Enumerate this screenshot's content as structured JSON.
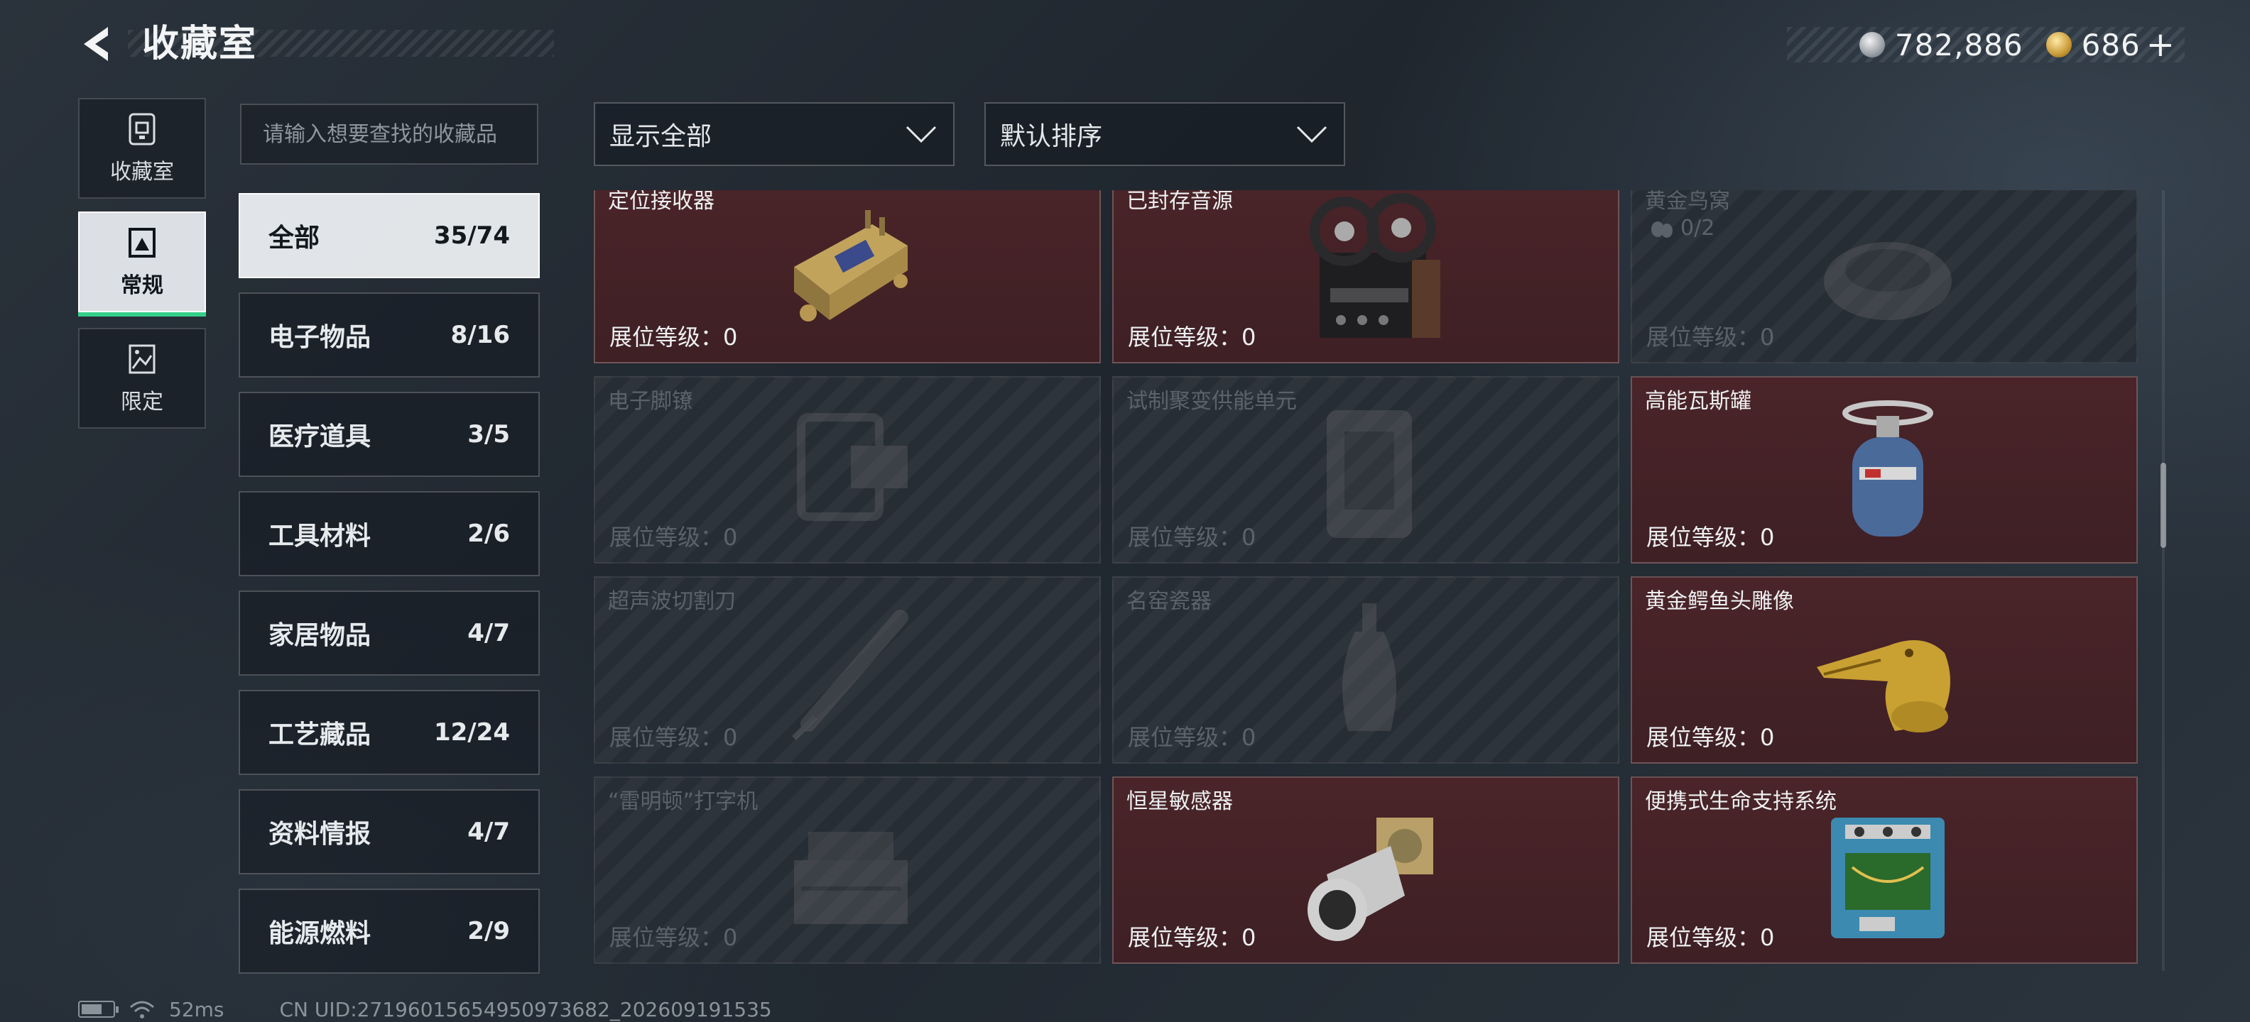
{
  "header": {
    "title": "收藏室"
  },
  "currency": {
    "silver": "782,886",
    "gold": "686",
    "plus": "+"
  },
  "side_tabs": [
    {
      "label": "收藏室",
      "icon": "vault-icon"
    },
    {
      "label": "常规",
      "icon": "picture-frame-icon",
      "active": true
    },
    {
      "label": "限定",
      "icon": "limited-frame-icon"
    }
  ],
  "search": {
    "placeholder": "请输入想要查找的收藏品"
  },
  "filters": {
    "show": "显示全部",
    "sort": "默认排序"
  },
  "categories": [
    {
      "name": "全部",
      "count": "35/74",
      "active": true
    },
    {
      "name": "电子物品",
      "count": "8/16"
    },
    {
      "name": "医疗道具",
      "count": "3/5"
    },
    {
      "name": "工具材料",
      "count": "2/6"
    },
    {
      "name": "家居物品",
      "count": "4/7"
    },
    {
      "name": "工艺藏品",
      "count": "12/24"
    },
    {
      "name": "资料情报",
      "count": "4/7"
    },
    {
      "name": "能源燃料",
      "count": "2/9"
    }
  ],
  "level_label": "展位等级：0",
  "items": [
    {
      "name": "定位接收器",
      "owned": true,
      "icon": "gps-receiver-icon"
    },
    {
      "name": "已封存音源",
      "owned": true,
      "icon": "reel-tape-recorder-icon"
    },
    {
      "name": "黄金鸟窝",
      "owned": false,
      "icon": "golden-nest-icon",
      "sub": "0/2"
    },
    {
      "name": "电子脚镣",
      "owned": false,
      "icon": "ankle-monitor-icon"
    },
    {
      "name": "试制聚变供能单元",
      "owned": false,
      "icon": "fusion-cell-icon"
    },
    {
      "name": "高能瓦斯罐",
      "owned": true,
      "icon": "gas-tank-icon"
    },
    {
      "name": "超声波切割刀",
      "owned": false,
      "icon": "ultrasonic-cutter-icon"
    },
    {
      "name": "名窑瓷器",
      "owned": false,
      "icon": "porcelain-vase-icon"
    },
    {
      "name": "黄金鳄鱼头雕像",
      "owned": true,
      "icon": "golden-crocodile-statue-icon"
    },
    {
      "name": "“雷明顿”打字机",
      "owned": false,
      "icon": "typewriter-icon"
    },
    {
      "name": "恒星敏感器",
      "owned": true,
      "icon": "star-sensor-icon"
    },
    {
      "name": "便携式生命支持系统",
      "owned": true,
      "icon": "life-support-system-icon"
    }
  ],
  "footer": {
    "ping": "52ms",
    "uid": "CN UID:27196015654950973682_202609191535"
  },
  "colors": {
    "accent": "#33d08a",
    "owned_card": "#4a2428",
    "locked_card": "#262d34"
  }
}
